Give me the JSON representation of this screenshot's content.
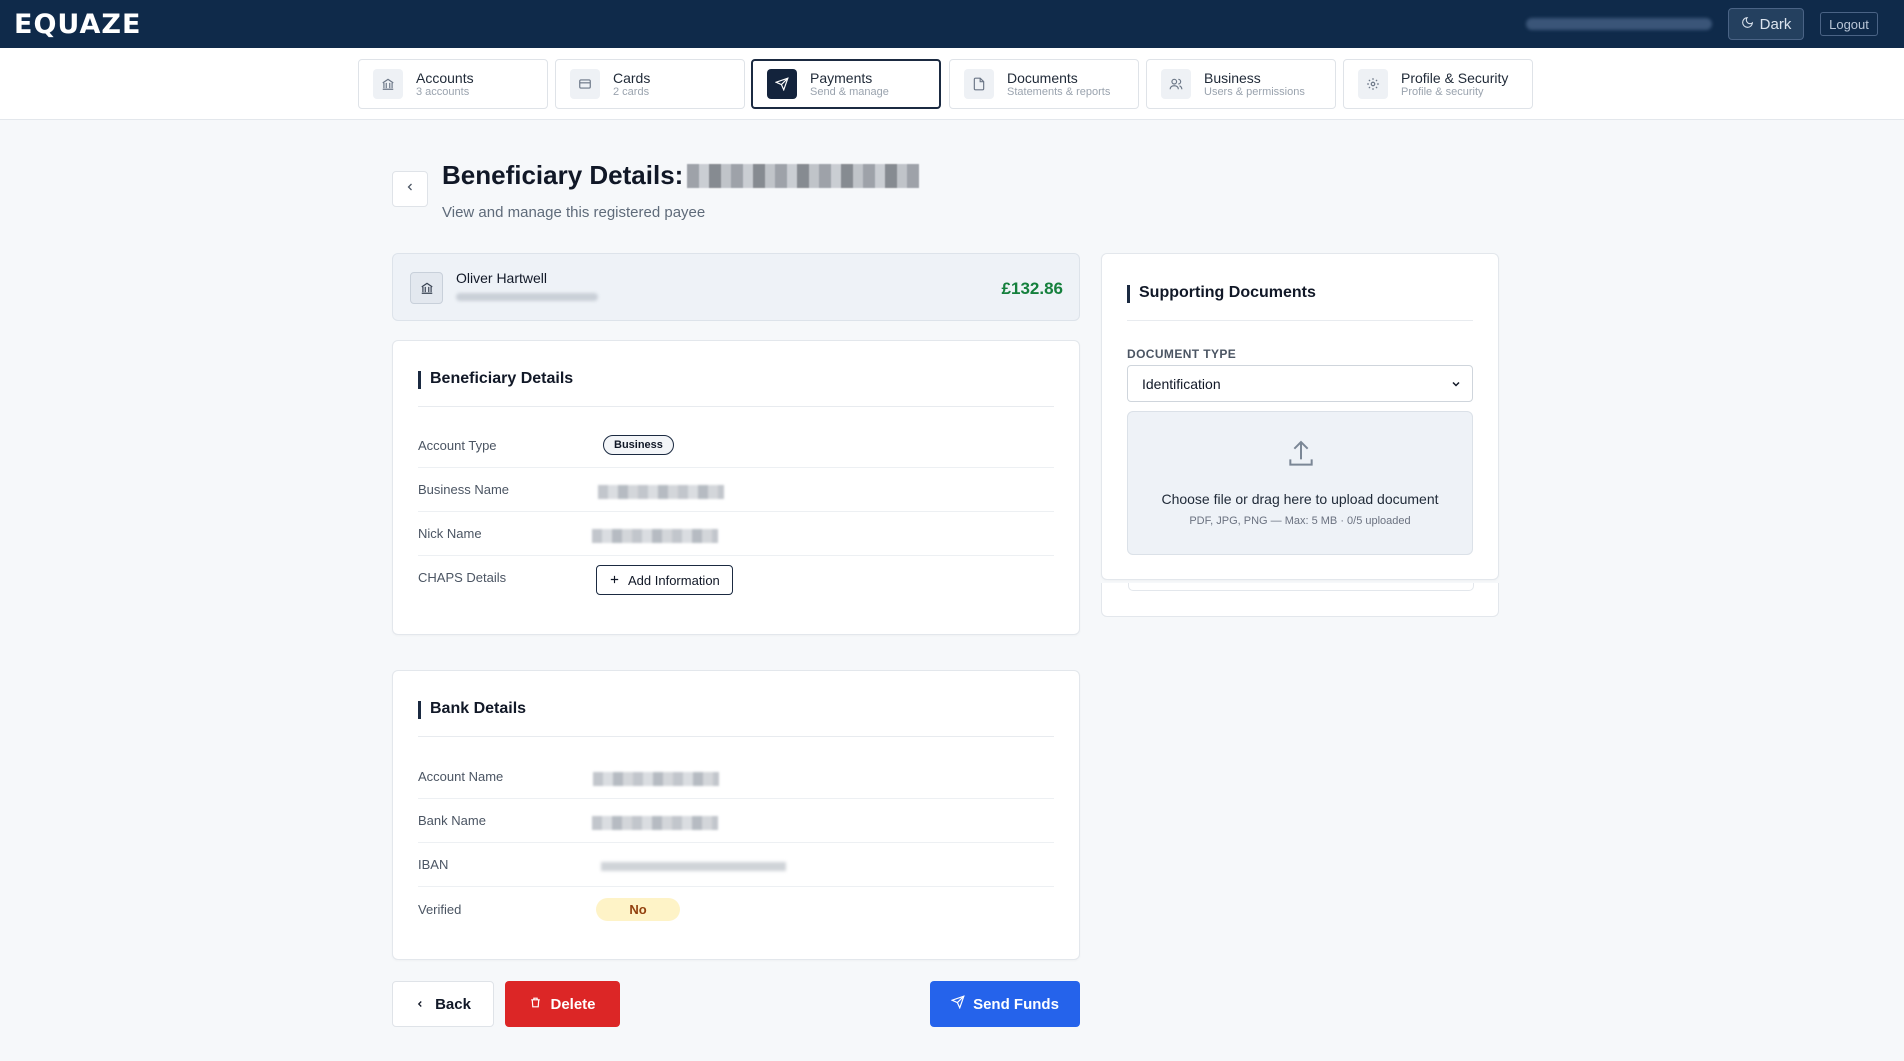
{
  "app": {
    "logo": "EQUAZE"
  },
  "header": {
    "theme_label": "Dark",
    "logout_label": "Logout"
  },
  "nav": {
    "tabs": [
      {
        "title": "Accounts",
        "sub": "3 accounts",
        "icon": "bank-icon"
      },
      {
        "title": "Cards",
        "sub": "2 cards",
        "icon": "card-icon"
      },
      {
        "title": "Payments",
        "sub": "Send & manage",
        "icon": "send-icon",
        "active": true
      },
      {
        "title": "Documents",
        "sub": "Statements & reports",
        "icon": "document-icon"
      },
      {
        "title": "Business",
        "sub": "Users & permissions",
        "icon": "users-icon"
      },
      {
        "title": "Profile & Security",
        "sub": "Profile & security",
        "icon": "gear-icon"
      }
    ]
  },
  "page": {
    "title": "Beneficiary Details:",
    "subtitle": "View and manage this registered payee"
  },
  "summary": {
    "name": "Oliver Hartwell",
    "amount": "£132.86"
  },
  "beneficiary": {
    "section_title": "Beneficiary Details",
    "account_type_label": "Account Type",
    "account_type_value": "Business",
    "business_name_label": "Business Name",
    "nick_name_label": "Nick Name",
    "chaps_label": "CHAPS Details",
    "add_info_label": "Add Information"
  },
  "bank": {
    "section_title": "Bank Details",
    "account_name_label": "Account Name",
    "bank_name_label": "Bank Name",
    "iban_label": "IBAN",
    "verified_label": "Verified",
    "verified_value": "No"
  },
  "documents": {
    "section_title": "Supporting Documents",
    "type_label": "DOCUMENT TYPE",
    "type_value": "Identification",
    "upload_text": "Choose file or drag here to upload document",
    "upload_hint": "PDF, JPG, PNG — Max: 5 MB · 0/5 uploaded"
  },
  "actions": {
    "back": "Back",
    "delete": "Delete",
    "send": "Send Funds"
  },
  "colors": {
    "topbar": "#0f2a4a",
    "amount": "#15803d",
    "delete": "#dc2626",
    "send": "#2563eb",
    "verified_bg": "#fef3c7"
  }
}
